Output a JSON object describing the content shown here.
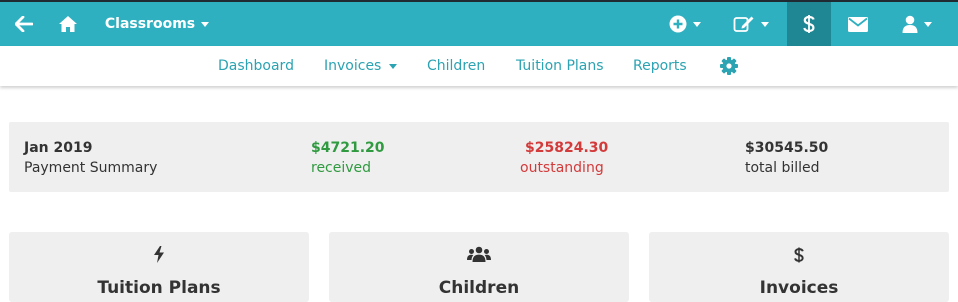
{
  "topbar": {
    "classrooms_label": "Classrooms",
    "accent": "#2eb0c0",
    "active_bg": "#1f8794",
    "icons": [
      "back-arrow-icon",
      "home-icon",
      "plus-circle-icon",
      "edit-icon",
      "dollar-icon",
      "envelope-icon",
      "user-icon"
    ]
  },
  "subnav": {
    "items": [
      {
        "label": "Dashboard"
      },
      {
        "label": "Invoices"
      },
      {
        "label": "Children"
      },
      {
        "label": "Tuition Plans"
      },
      {
        "label": "Reports"
      }
    ],
    "settings_icon": "gear-icon"
  },
  "summary": {
    "period": "Jan 2019",
    "subtitle": "Payment Summary",
    "received": {
      "amount": "$4721.20",
      "label": "received",
      "color": "#2f9a3f"
    },
    "outstanding": {
      "amount": "$25824.30",
      "label": "outstanding",
      "color": "#d33a3a"
    },
    "billed": {
      "amount": "$30545.50",
      "label": "total billed",
      "color": "#333333"
    }
  },
  "cards": [
    {
      "icon": "bolt-icon",
      "title": "Tuition Plans"
    },
    {
      "icon": "users-icon",
      "title": "Children"
    },
    {
      "icon": "dollar-icon",
      "title": "Invoices"
    }
  ]
}
